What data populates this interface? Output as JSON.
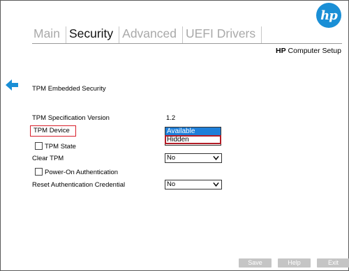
{
  "brand": {
    "logo_text": "hp",
    "logo_color": "#1a8fd6"
  },
  "tabs": [
    {
      "label": "Main",
      "active": false
    },
    {
      "label": "Security",
      "active": true
    },
    {
      "label": "Advanced",
      "active": false
    },
    {
      "label": "UEFI Drivers",
      "active": false
    }
  ],
  "app_title": {
    "bold": "HP",
    "rest": " Computer Setup"
  },
  "back_icon": "left-arrow-icon",
  "section": {
    "heading": "TPM Embedded Security"
  },
  "settings": {
    "spec_version": {
      "label": "TPM Specification Version",
      "value": "1.2"
    },
    "tpm_device": {
      "label": "TPM Device",
      "options": [
        "Available",
        "Hidden"
      ],
      "selected": "Available"
    },
    "tpm_state": {
      "label": "TPM State",
      "checked": false
    },
    "clear_tpm": {
      "label": "Clear TPM",
      "value": "No"
    },
    "power_on_auth": {
      "label": "Power-On Authentication",
      "checked": false
    },
    "reset_auth": {
      "label": "Reset Authentication Credential",
      "value": "No"
    }
  },
  "footer": {
    "save": "Save",
    "help": "Help",
    "exit": "Exit"
  },
  "colors": {
    "accent": "#1e7fd9",
    "highlight": "#d81e2a",
    "disabled_button": "#c5c5c5"
  }
}
